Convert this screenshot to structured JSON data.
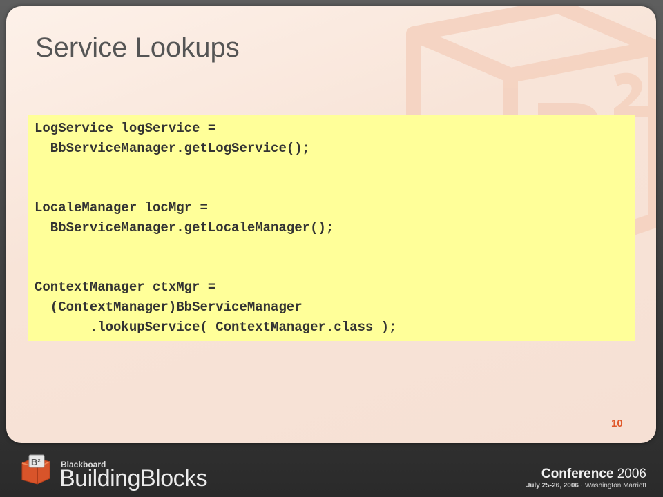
{
  "slide": {
    "title": "Service Lookups",
    "page_number": "10"
  },
  "code": {
    "lines": [
      "LogService logService =",
      "  BbServiceManager.getLogService();",
      "",
      "",
      "LocaleManager locMgr =",
      "  BbServiceManager.getLocaleManager();",
      "",
      "",
      "ContextManager ctxMgr =",
      "  (ContextManager)BbServiceManager",
      "       .lookupService( ContextManager.class );"
    ]
  },
  "footer": {
    "brand_small": "Blackboard",
    "brand_large": "BuildingBlocks",
    "logo_text": "B2",
    "conference_word": "Conference",
    "conference_year": " 2006",
    "conference_dates": "July 25-26, 2006",
    "conference_location": " · Washington Marriott"
  },
  "colors": {
    "code_background": "#ffff99",
    "accent": "#e0582a",
    "title": "#555555"
  }
}
